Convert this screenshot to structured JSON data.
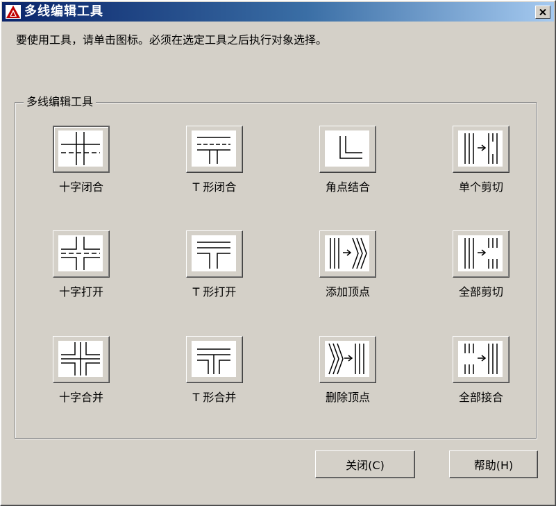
{
  "window": {
    "title": "多线编辑工具",
    "app_icon": "autocad-logo-icon",
    "close_icon": "close-x-icon"
  },
  "instruction": "要使用工具，请单击图标。必须在选定工具之后执行对象选择。",
  "group": {
    "legend": "多线编辑工具",
    "tools": [
      {
        "label": "十字闭合",
        "icon": "cross-closed-icon",
        "selected": true
      },
      {
        "label": "T 形闭合",
        "icon": "tee-closed-icon"
      },
      {
        "label": "角点结合",
        "icon": "corner-joint-icon"
      },
      {
        "label": "单个剪切",
        "icon": "cut-single-icon"
      },
      {
        "label": "十字打开",
        "icon": "cross-open-icon"
      },
      {
        "label": "T 形打开",
        "icon": "tee-open-icon"
      },
      {
        "label": "添加顶点",
        "icon": "add-vertex-icon"
      },
      {
        "label": "全部剪切",
        "icon": "cut-all-icon"
      },
      {
        "label": "十字合并",
        "icon": "cross-merged-icon"
      },
      {
        "label": "T 形合并",
        "icon": "tee-merged-icon"
      },
      {
        "label": "删除顶点",
        "icon": "delete-vertex-icon"
      },
      {
        "label": "全部接合",
        "icon": "weld-all-icon"
      }
    ]
  },
  "buttons": {
    "close": "关闭(C)",
    "help": "帮助(H)"
  },
  "colors": {
    "face": "#d4d0c8",
    "title_start": "#0a246a",
    "title_end": "#a6caf0",
    "logo_red": "#c00000"
  }
}
